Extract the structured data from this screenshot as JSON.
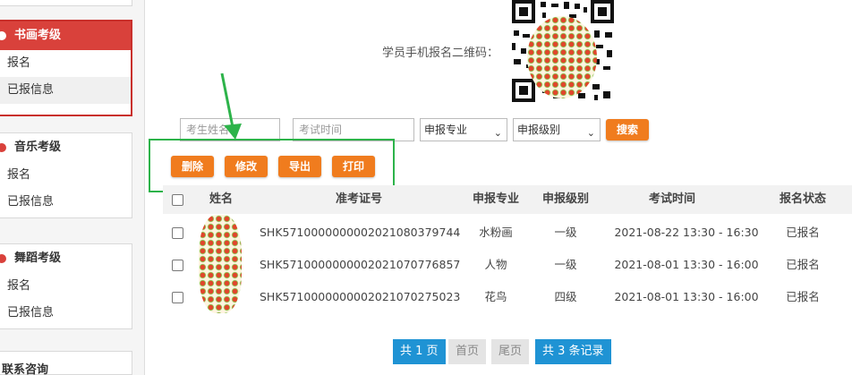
{
  "sidebar": {
    "sections": [
      {
        "title": "书画考级",
        "items": [
          "报名",
          "已报信息"
        ],
        "active": true
      },
      {
        "title": "音乐考级",
        "items": [
          "报名",
          "已报信息"
        ],
        "active": false
      },
      {
        "title": "舞蹈考级",
        "items": [
          "报名",
          "已报信息"
        ],
        "active": false
      }
    ],
    "contact": "联系咨询"
  },
  "qr": {
    "label": "学员手机报名二维码："
  },
  "filters": {
    "name_placeholder": "考生姓名",
    "time_placeholder": "考试时间",
    "major_select": "申报专业",
    "level_select": "申报级别",
    "search_label": "搜索"
  },
  "actions": {
    "delete": "删除",
    "edit": "修改",
    "export": "导出",
    "print": "打印"
  },
  "table": {
    "headers": [
      "姓名",
      "准考证号",
      "申报专业",
      "申报级别",
      "考试时间",
      "报名状态"
    ],
    "rows": [
      {
        "id": "SHK5710000000002021080379744",
        "major": "水粉画",
        "level": "一级",
        "time": "2021-08-22 13:30 - 16:30",
        "status": "已报名"
      },
      {
        "id": "SHK5710000000002021070776857",
        "major": "人物",
        "level": "一级",
        "time": "2021-08-01 13:30 - 16:00",
        "status": "已报名"
      },
      {
        "id": "SHK5710000000002021070275023",
        "major": "花鸟",
        "level": "四级",
        "time": "2021-08-01 13:30 - 16:00",
        "status": "已报名"
      }
    ]
  },
  "pagination": {
    "pages": "共 1 页",
    "first": "首页",
    "last": "尾页",
    "records": "共 3 条记录"
  },
  "colors": {
    "accent_red": "#d9413b",
    "button_orange": "#f07c1e",
    "annotation_green": "#2db34a",
    "pagination_blue": "#1f93d4"
  }
}
